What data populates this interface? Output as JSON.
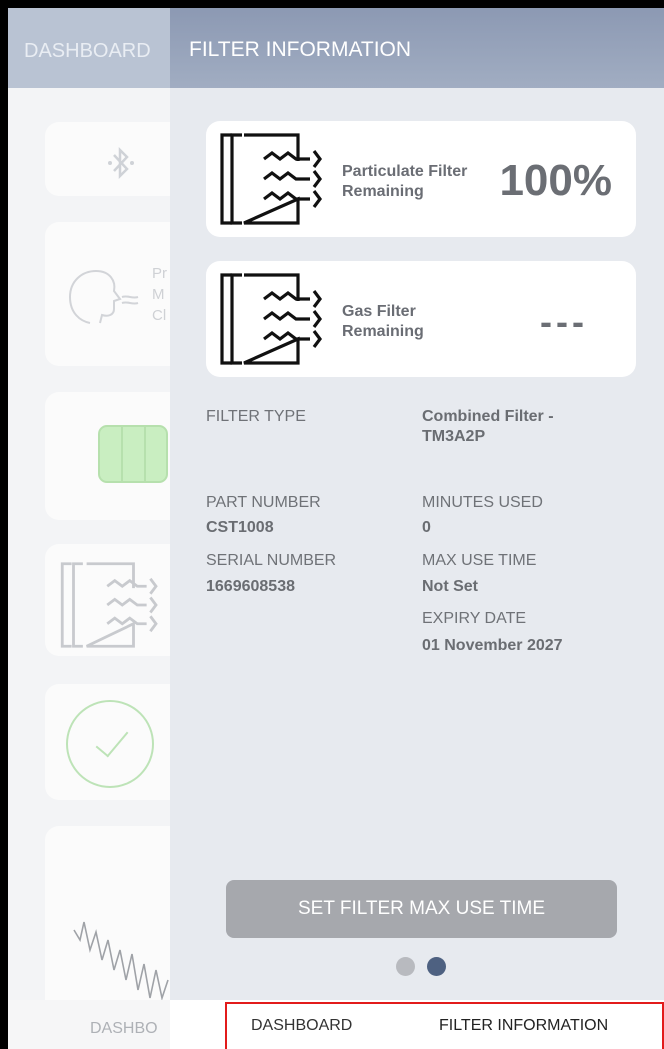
{
  "background": {
    "header_title": "DASHBOARD",
    "footer_label": "DASHBO",
    "card_text_fragments": [
      "Pr",
      "M",
      "Cl"
    ]
  },
  "panel": {
    "title": "FILTER INFORMATION",
    "particulate": {
      "label_line1": "Particulate Filter",
      "label_line2": "Remaining",
      "value": "100%"
    },
    "gas": {
      "label_line1": "Gas Filter",
      "label_line2": "Remaining",
      "value": "---"
    },
    "filter_type": {
      "label": "FILTER TYPE",
      "value_line1": "Combined Filter -",
      "value_line2": "TM3A2P"
    },
    "part_number": {
      "label": "PART NUMBER",
      "value": "CST1008"
    },
    "serial_number": {
      "label": "SERIAL NUMBER",
      "value": "1669608538"
    },
    "minutes_used": {
      "label": "MINUTES USED",
      "value": "0"
    },
    "max_use_time": {
      "label": "MAX USE TIME",
      "value": "Not Set"
    },
    "expiry_date": {
      "label": "EXPIRY DATE",
      "value": "01 November 2027"
    },
    "set_button_label": "SET FILTER MAX USE TIME",
    "page_indicator": {
      "count": 2,
      "active_index": 1
    }
  },
  "tabs": [
    {
      "label": "DASHBOARD"
    },
    {
      "label": "FILTER INFORMATION",
      "selected": true
    }
  ],
  "colors": {
    "header": "#8c99b3",
    "panel_bg": "#e7eaef",
    "dot_active": "#4e6181",
    "dot_inactive": "#b8babf",
    "highlight": "#e21b1b"
  }
}
